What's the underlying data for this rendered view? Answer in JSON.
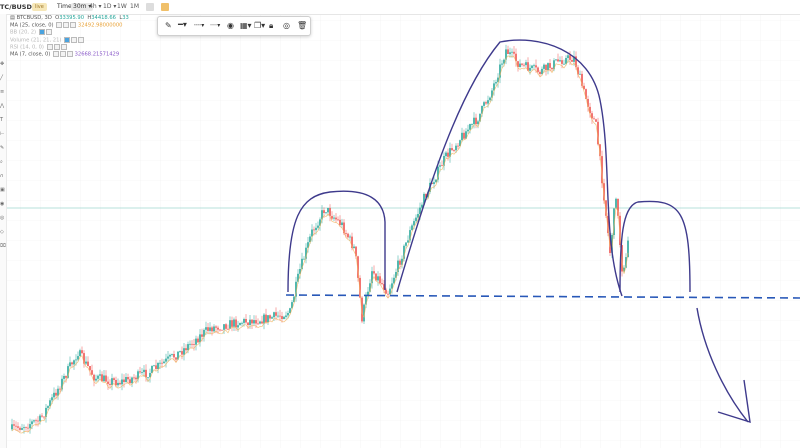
{
  "toolbar": {
    "symbol": "TC/BUSD",
    "live_badge": "live",
    "time_label": "Time",
    "interval": "30m ▾",
    "timeframes": [
      "4h ▾",
      "1D ▾",
      "1W",
      "1M"
    ]
  },
  "legend": {
    "title": "BTCBUSD, 3D",
    "open_label": "O",
    "open_value": "33395.90",
    "high_label": "H",
    "high_value": "34418.66",
    "low_label": "L",
    "low_value": "33",
    "ma25_label": "MA (25, close, 0)",
    "ma25_value": "32492.98000000",
    "ind2_label": "BB (20, 2)",
    "ind3_label": "Volume (21, 21, 21)",
    "ind4_label": "RSI (14, 0, 0)",
    "ma7_label": "MA (7, close, 0)",
    "ma7_value": "32668.21571429"
  },
  "drawing_toolbar": {
    "icons": [
      "pencil-icon",
      "line-style-icon",
      "dashed-line-icon",
      "dotted-line-icon",
      "circle-icon",
      "fill-icon",
      "copy-icon",
      "lock-icon",
      "eye-icon",
      "trash-icon"
    ]
  },
  "colors": {
    "up_candle": "#26a69a",
    "down_candle": "#ef5350",
    "ma_orange": "#f0b35a",
    "annotation_purple": "#3e3a8c",
    "support_line_blue": "#2858b8",
    "horizontal_line_teal": "#9fd6cf"
  },
  "chart_data": {
    "type": "candlestick",
    "series": [
      {
        "name": "MA (25, close, 0)",
        "values": []
      },
      {
        "name": "MA (7, close, 0)",
        "values": []
      }
    ]
  }
}
